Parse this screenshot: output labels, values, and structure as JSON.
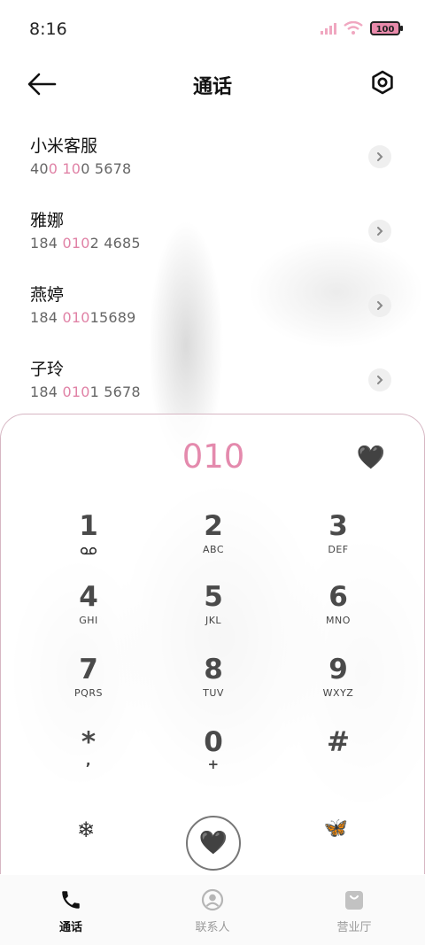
{
  "status_bar": {
    "time": "8:16",
    "battery": "100",
    "icons": [
      "signal-icon",
      "wifi-icon",
      "battery-icon"
    ]
  },
  "header": {
    "title": "通话",
    "back_icon": "arrow-left-icon",
    "settings_icon": "gear-icon"
  },
  "calls": [
    {
      "name": "小米客服",
      "number_pre": "40",
      "number_hl": "0 10",
      "number_post": "0 5678"
    },
    {
      "name": "雅娜",
      "number_pre": "184 ",
      "number_hl": "010",
      "number_post": "2 4685"
    },
    {
      "name": "燕婷",
      "number_pre": "184 ",
      "number_hl": "010",
      "number_post": "15689"
    },
    {
      "name": "子玲",
      "number_pre": "184 ",
      "number_hl": "010",
      "number_post": "1 5678"
    }
  ],
  "dialpad": {
    "display": "010",
    "accent_color": "#e48aad",
    "keys": [
      {
        "digit": "1",
        "letters": ""
      },
      {
        "digit": "2",
        "letters": "ABC"
      },
      {
        "digit": "3",
        "letters": "DEF"
      },
      {
        "digit": "4",
        "letters": "GHI"
      },
      {
        "digit": "5",
        "letters": "JKL"
      },
      {
        "digit": "6",
        "letters": "MNO"
      },
      {
        "digit": "7",
        "letters": "PQRS"
      },
      {
        "digit": "8",
        "letters": "TUV"
      },
      {
        "digit": "9",
        "letters": "WXYZ"
      },
      {
        "digit": "*",
        "letters": ","
      },
      {
        "digit": "0",
        "letters": "+"
      },
      {
        "digit": "#",
        "letters": ""
      }
    ]
  },
  "bottom_nav": {
    "items": [
      {
        "label": "通话",
        "icon": "phone-icon",
        "active": true
      },
      {
        "label": "联系人",
        "icon": "contact-icon",
        "active": false
      },
      {
        "label": "营业厅",
        "icon": "shopping-bag-icon",
        "active": false
      }
    ]
  }
}
